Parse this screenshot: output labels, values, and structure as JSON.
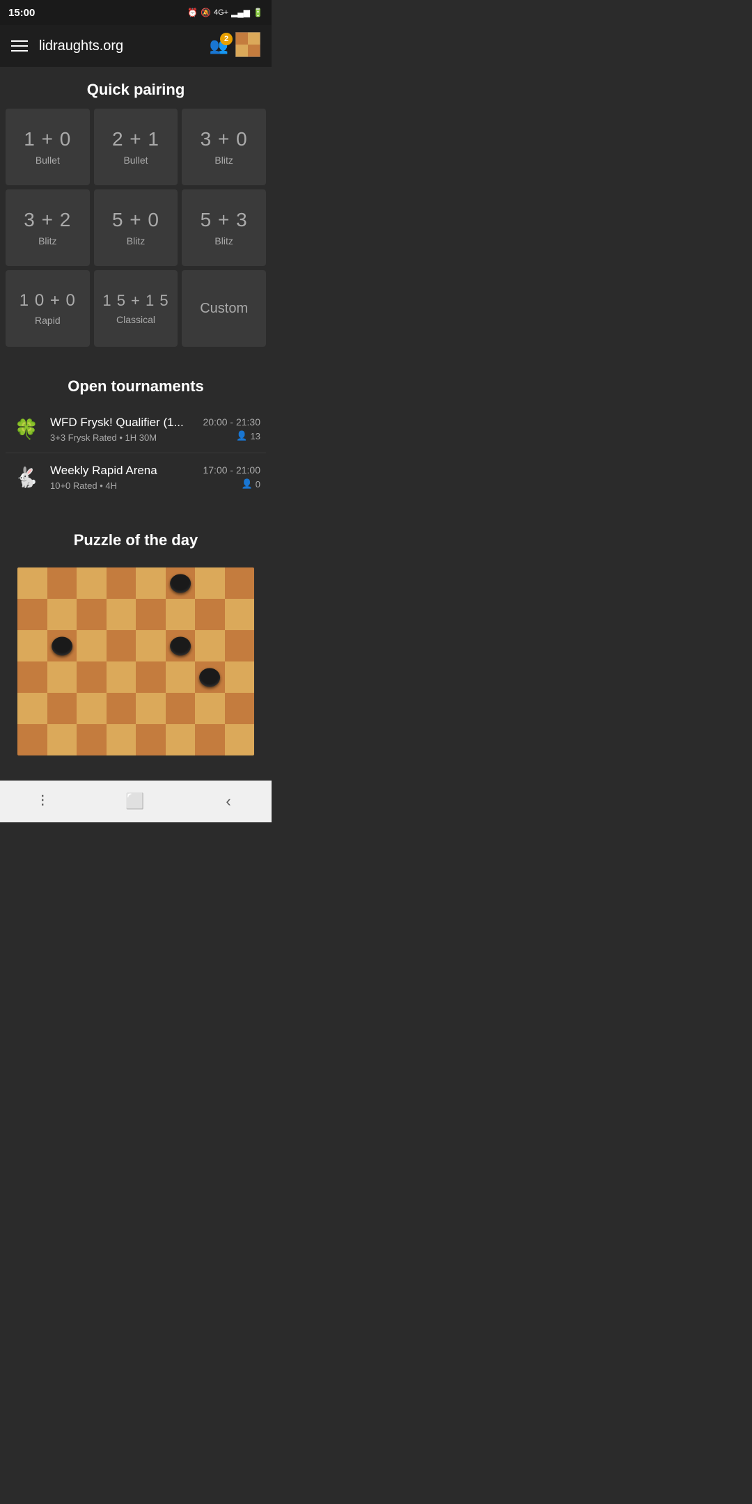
{
  "statusBar": {
    "time": "15:00",
    "icons": "alarm signal battery"
  },
  "header": {
    "title": "lidraughts.org",
    "notificationCount": "2"
  },
  "quickPairing": {
    "sectionTitle": "Quick pairing",
    "cards": [
      {
        "time": "1 + 0",
        "label": "Bullet"
      },
      {
        "time": "2 + 1",
        "label": "Bullet"
      },
      {
        "time": "3 + 0",
        "label": "Blitz"
      },
      {
        "time": "3 + 2",
        "label": "Blitz"
      },
      {
        "time": "5 + 0",
        "label": "Blitz"
      },
      {
        "time": "5 + 3",
        "label": "Blitz"
      },
      {
        "time": "1 0 + 0",
        "label": "Rapid"
      },
      {
        "time": "1 5 + 1 5",
        "label": "Classical"
      },
      {
        "time": "Custom",
        "label": ""
      }
    ]
  },
  "openTournaments": {
    "sectionTitle": "Open tournaments",
    "items": [
      {
        "name": "WFD Frysk! Qualifier (1...",
        "details": "3+3 Frysk Rated • 1H 30M",
        "timeRange": "20:00 - 21:30",
        "players": "13",
        "iconType": "hearts"
      },
      {
        "name": "Weekly Rapid Arena",
        "details": "10+0 Rated • 4H",
        "timeRange": "17:00 - 21:00",
        "players": "0",
        "iconType": "rabbit"
      }
    ]
  },
  "puzzle": {
    "sectionTitle": "Puzzle of the day"
  },
  "bottomNav": {
    "backIcon": "‹",
    "homeIcon": "□",
    "menuIcon": "|||"
  }
}
